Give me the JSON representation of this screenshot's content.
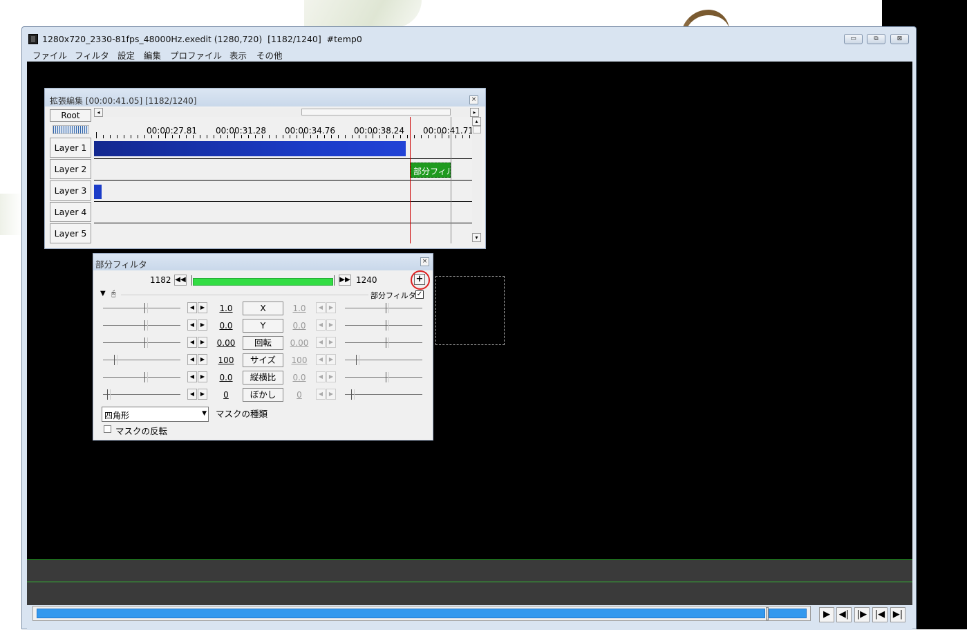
{
  "window": {
    "title": "1280x720_2330-81fps_48000Hz.exedit (1280,720)  [1182/1240]  #temp0",
    "buttons": {
      "minimize": "▭",
      "restore": "⧉",
      "close": "⊠"
    }
  },
  "menu": [
    "ファイル",
    "フィルタ",
    "設定",
    "編集",
    "プロファイル",
    "表示",
    "その他"
  ],
  "timeline": {
    "title": "拡張編集 [00:00:41.05] [1182/1240]",
    "root_label": "Root",
    "ruler_labels": [
      "00:00:27.81",
      "00:00:31.28",
      "00:00:34.76",
      "00:00:38.24",
      "00:00:41.71"
    ],
    "layers": [
      "Layer 1",
      "Layer 2",
      "Layer 3",
      "Layer 4",
      "Layer 5"
    ],
    "clip_label": "部分フィル"
  },
  "filter": {
    "title": "部分フィルタ",
    "start_frame": "1182",
    "end_frame": "1240",
    "add_button": "+",
    "object_name": "部分フィルタ",
    "object_enabled": true,
    "params": [
      {
        "name": "X",
        "start": "1.0",
        "end": "1.0"
      },
      {
        "name": "Y",
        "start": "0.0",
        "end": "0.0"
      },
      {
        "name": "回転",
        "start": "0.00",
        "end": "0.00"
      },
      {
        "name": "サイズ",
        "start": "100",
        "end": "100"
      },
      {
        "name": "縦横比",
        "start": "0.0",
        "end": "0.0"
      },
      {
        "name": "ぼかし",
        "start": "0",
        "end": "0"
      }
    ],
    "mask_type_value": "四角形",
    "mask_type_label": "マスクの種類",
    "invert_label": "マスクの反転",
    "invert_checked": false
  },
  "colors": {
    "canvas": "#000000",
    "clip_blue": "#1b3cc8",
    "clip_green": "#1f9a1f",
    "seek_blue": "#3399ee",
    "playhead": "#cc0000"
  },
  "player_controls": [
    "play-icon",
    "prev-frame-icon",
    "next-frame-icon",
    "go-start-icon",
    "go-end-icon"
  ]
}
